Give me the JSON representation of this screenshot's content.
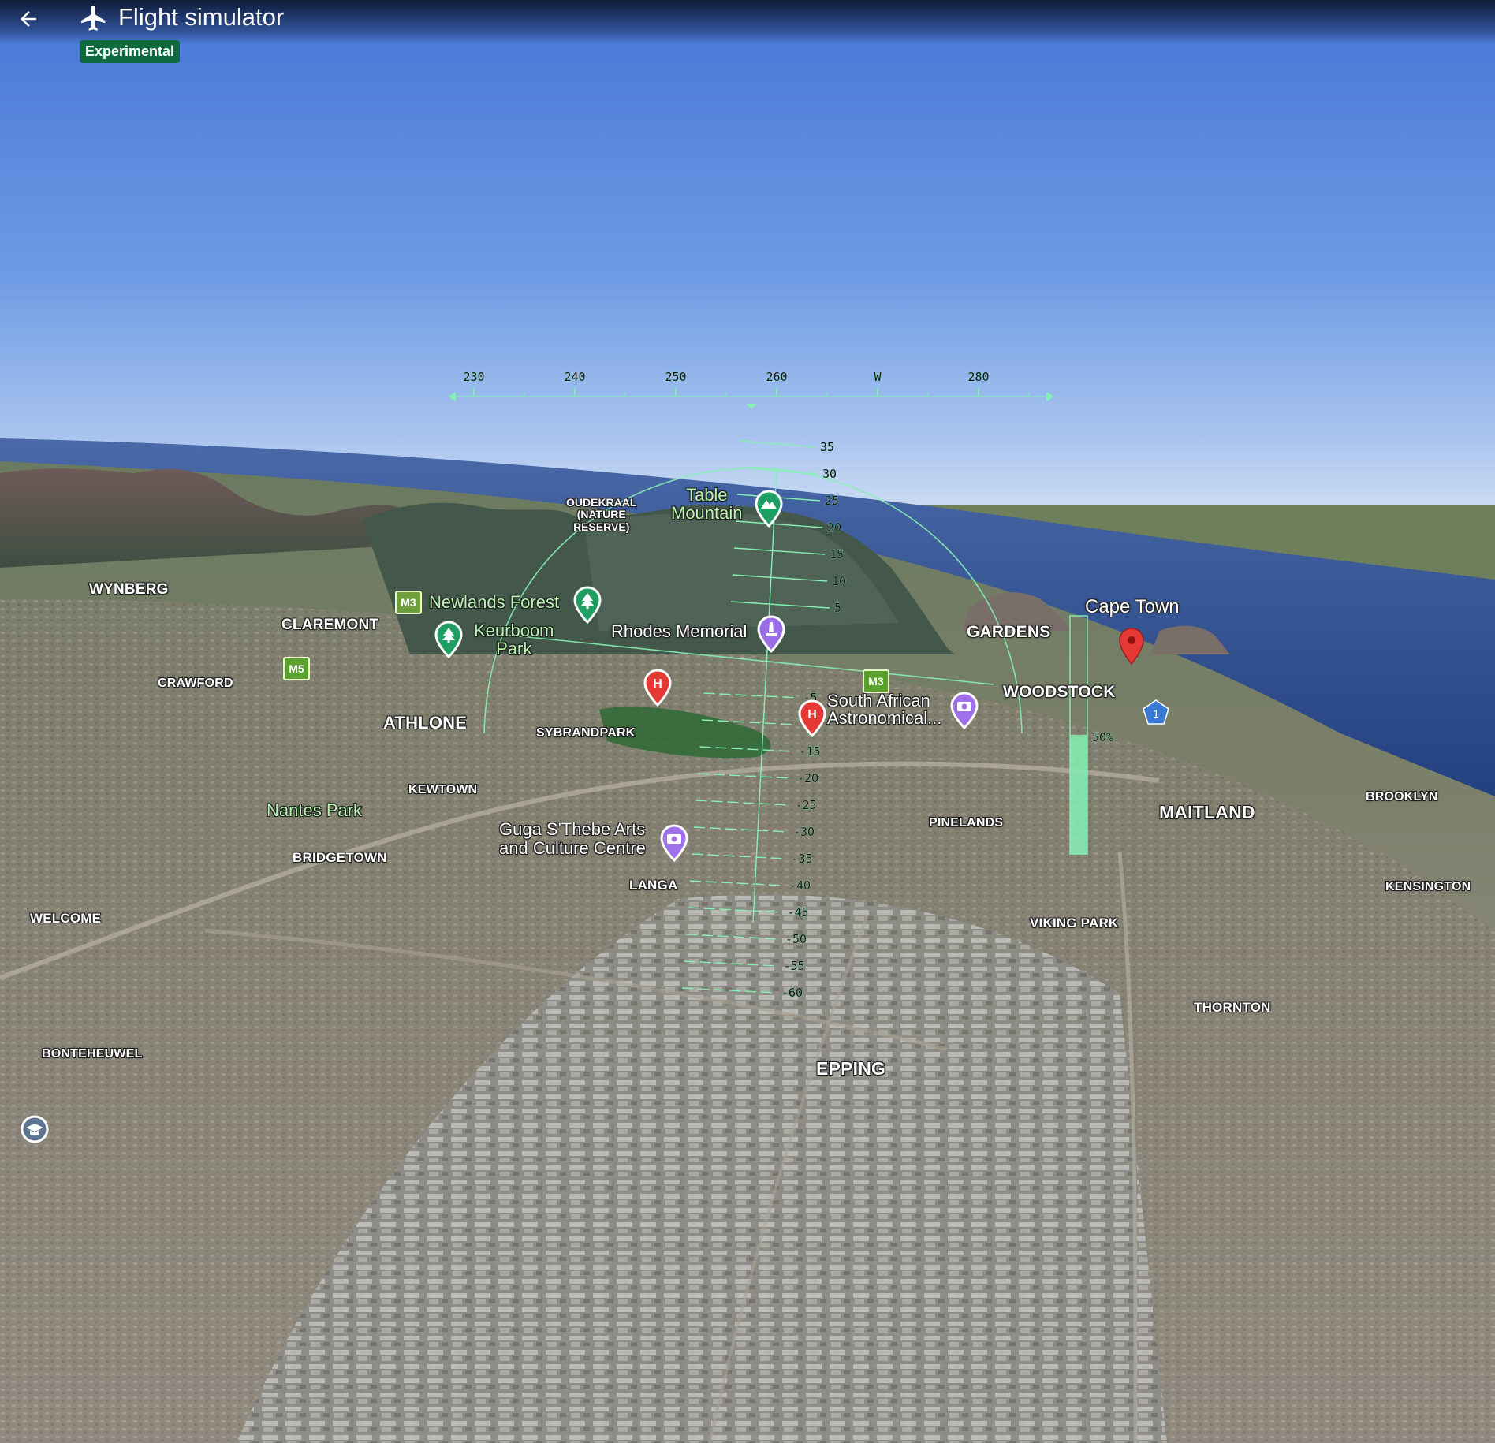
{
  "app": {
    "title": "Flight simulator",
    "badge": "Experimental"
  },
  "icons": {
    "back": "arrow-left-icon",
    "app": "airplane-icon"
  },
  "colors": {
    "hud": "#86f0b4",
    "badge": "#0f6b3f",
    "sky_top": "#4a7fd9",
    "sky_horizon": "#b7cdf0"
  },
  "hud": {
    "heading_labels": [
      "230",
      "240",
      "250",
      "260",
      "W",
      "280"
    ],
    "pitch_labels_up": [
      "35",
      "30",
      "25",
      "20",
      "15",
      "10",
      "5"
    ],
    "pitch_labels_down": [
      "-5",
      "-10",
      "-15",
      "-20",
      "-25",
      "-30",
      "-35",
      "-40",
      "-45",
      "-50",
      "-55",
      "-60"
    ],
    "throttle_label": "50%",
    "throttle_level": 0.5
  },
  "map": {
    "districts": {
      "wynberg": "WYNBERG",
      "claremont": "CLAREMONT",
      "crawford": "CRAWFORD",
      "athlone": "ATHLONE",
      "sybrandpark": "SYBRANDPARK",
      "kewtown": "KEWTOWN",
      "bridgetown": "BRIDGETOWN",
      "welcome": "WELCOME",
      "bonteheuwel": "BONTEHEUWEL",
      "langa": "LANGA",
      "pinelands": "PINELANDS",
      "gardens": "GARDENS",
      "woodstock": "WOODSTOCK",
      "maitland": "MAITLAND",
      "brooklyn": "BROOKLYN",
      "kensington": "KENSINGTON",
      "viking_park": "VIKING PARK",
      "thornton": "THORNTON",
      "epping": "EPPING"
    },
    "nature_reserve": [
      "OUDEKRAAL",
      "(NATURE",
      "RESERVE)"
    ],
    "parks": {
      "newlands_forest": "Newlands Forest",
      "keurboom_park": [
        "Keurboom",
        "Park"
      ],
      "nantes_park": "Nantes Park"
    },
    "pois": {
      "table_mountain": [
        "Table",
        "Mountain"
      ],
      "rhodes_memorial": "Rhodes Memorial",
      "saao": [
        "South African",
        "Astronomical..."
      ],
      "guga": [
        "Guga S'Thebe Arts",
        "and Culture Centre"
      ],
      "cape_town": "Cape Town"
    },
    "routes": {
      "m3_west": "M3",
      "m5": "M5",
      "m3_east": "M3",
      "n1": "1"
    },
    "pin_icons": {
      "hospital": "H"
    }
  }
}
